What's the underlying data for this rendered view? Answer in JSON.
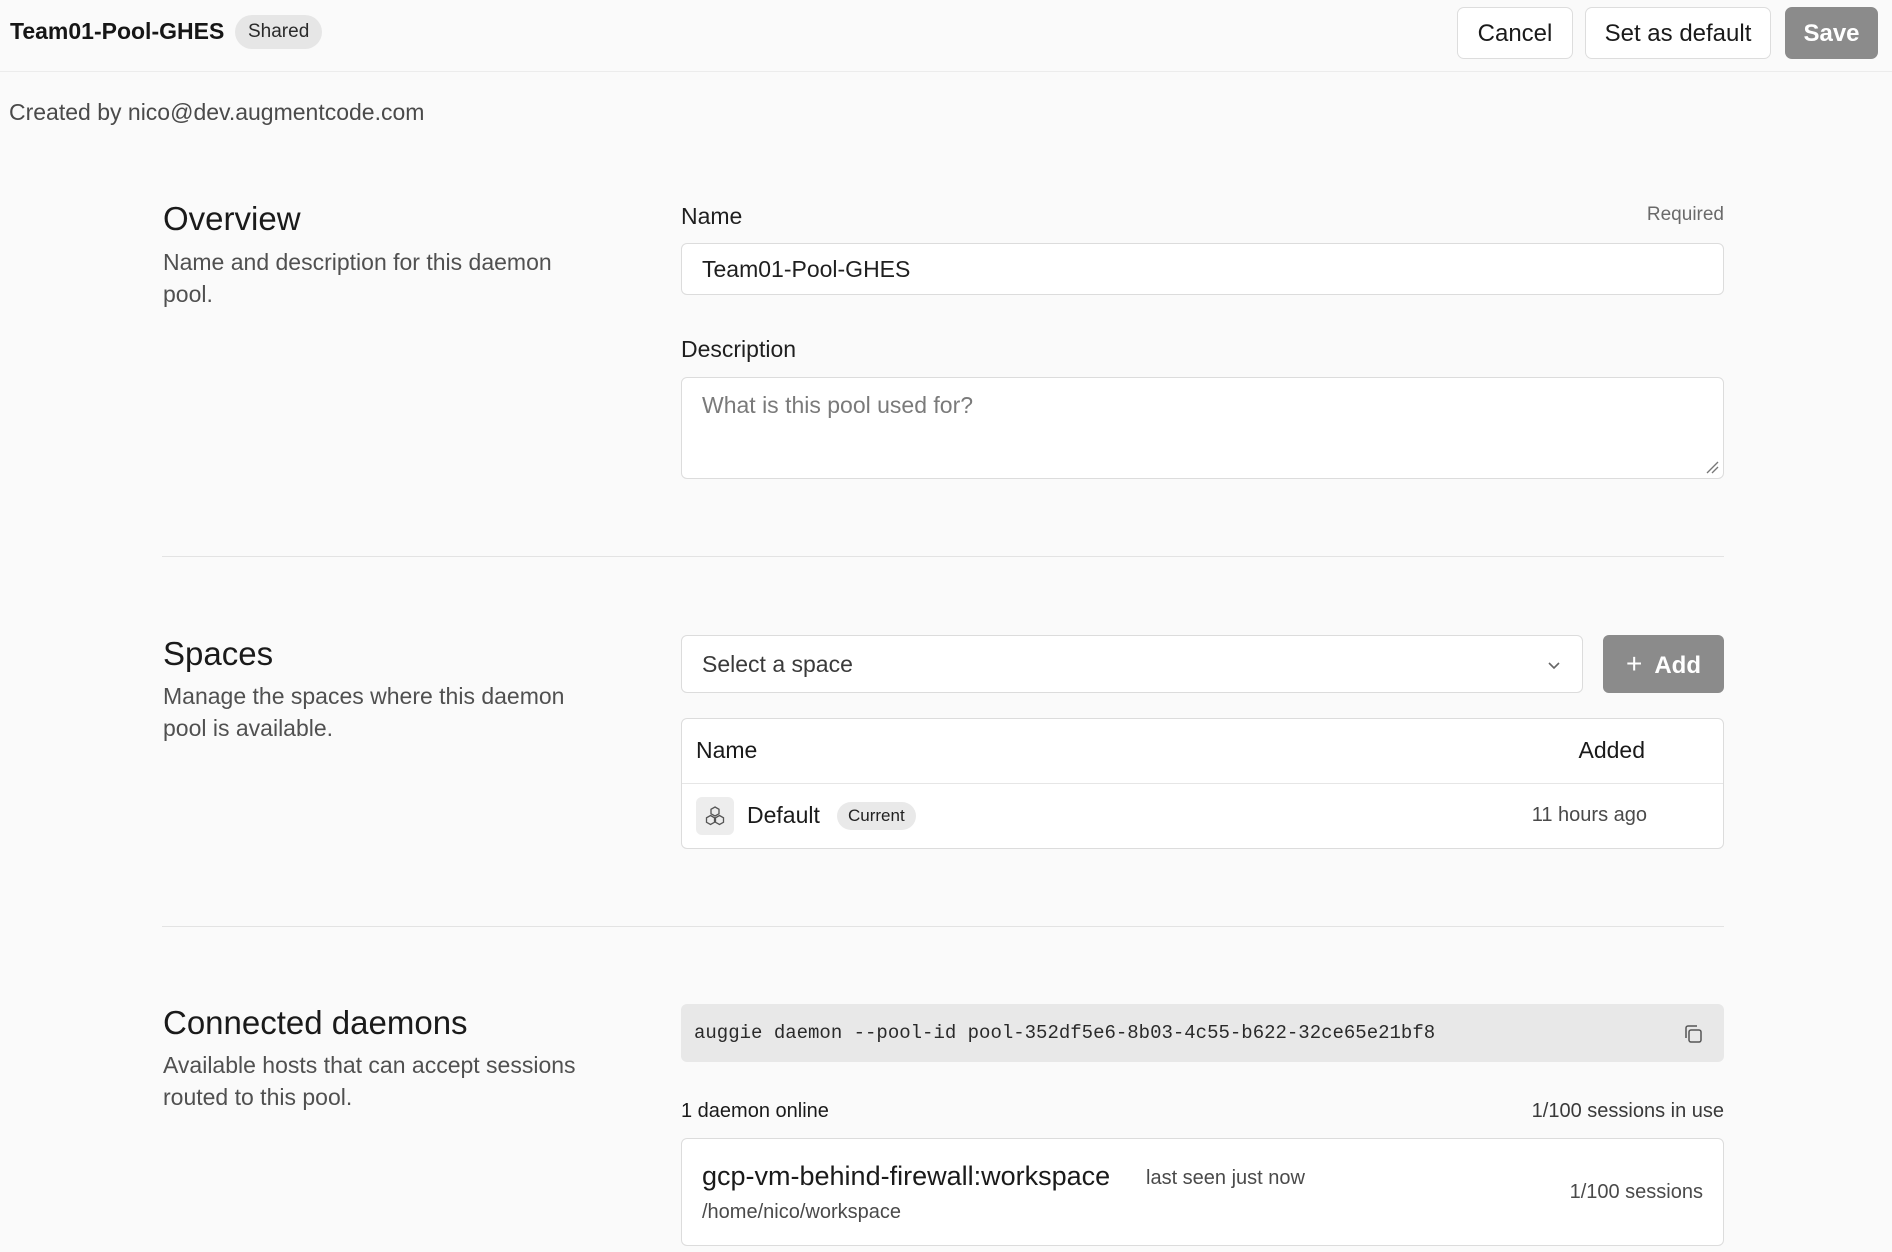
{
  "header": {
    "pool_name": "Team01-Pool-GHES",
    "badge": "Shared",
    "cancel_label": "Cancel",
    "set_default_label": "Set as default",
    "save_label": "Save"
  },
  "created_by": "Created by nico@dev.augmentcode.com",
  "overview": {
    "title": "Overview",
    "description": "Name and description for this daemon pool.",
    "name_label": "Name",
    "required_label": "Required",
    "name_value": "Team01-Pool-GHES",
    "description_label": "Description",
    "description_placeholder": "What is this pool used for?"
  },
  "spaces": {
    "title": "Spaces",
    "description": "Manage the spaces where this daemon pool is available.",
    "select_placeholder": "Select a space",
    "add_label": "Add",
    "table": {
      "col_name": "Name",
      "col_added": "Added",
      "rows": [
        {
          "name": "Default",
          "badge": "Current",
          "added": "11 hours ago",
          "icon": "cubes-icon"
        }
      ]
    }
  },
  "daemons": {
    "title": "Connected daemons",
    "description": "Available hosts that can accept sessions routed to this pool.",
    "command": "auggie daemon --pool-id pool-352df5e6-8b03-4c55-b622-32ce65e21bf8",
    "online_count": "1 daemon online",
    "sessions_in_use": "1/100 sessions in use",
    "items": [
      {
        "name": "gcp-vm-behind-firewall:workspace",
        "last_seen": "last seen just now",
        "path": "/home/nico/workspace",
        "sessions": "1/100 sessions"
      }
    ]
  },
  "colors": {
    "primary_button": "#8b8b8b",
    "background": "#fafafa"
  }
}
